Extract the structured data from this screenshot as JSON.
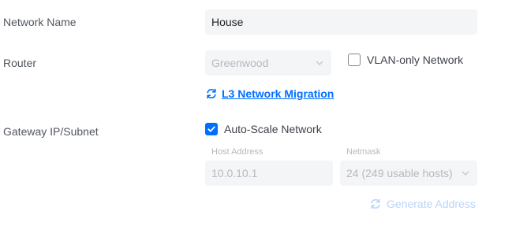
{
  "form": {
    "network_name": {
      "label": "Network Name",
      "value": "House"
    },
    "router": {
      "label": "Router",
      "selected": "Greenwood",
      "vlan_only_label": "VLAN-only Network",
      "vlan_only_checked": false,
      "migration_link": "L3 Network Migration"
    },
    "gateway": {
      "label": "Gateway IP/Subnet",
      "auto_scale_label": "Auto-Scale Network",
      "auto_scale_checked": true,
      "host_address_label": "Host Address",
      "host_address_value": "10.0.10.1",
      "netmask_label": "Netmask",
      "netmask_value": "24 (249 usable hosts)",
      "generate_label": "Generate Address"
    }
  },
  "colors": {
    "accent": "#006fff",
    "accent_disabled": "#b9d5fb",
    "input_bg": "#f4f5f6",
    "label_text": "#50565e",
    "disabled_text": "#b6b9be"
  },
  "icons": {
    "migration": "refresh-icon",
    "select_arrow": "chevron-down-icon",
    "generate": "refresh-icon"
  }
}
